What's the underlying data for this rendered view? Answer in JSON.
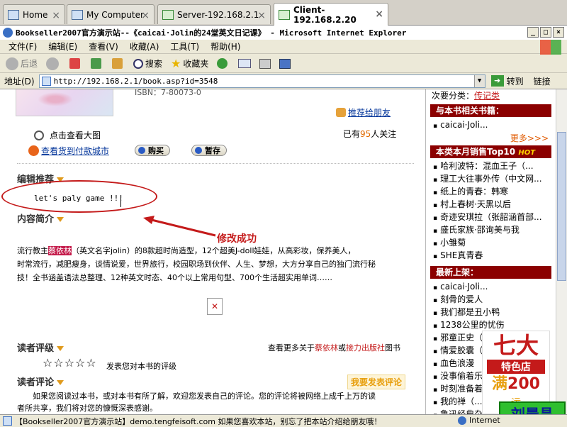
{
  "tabs": [
    {
      "label": "Home"
    },
    {
      "label": "My Computer"
    },
    {
      "label": "Server-192.168.2.1"
    },
    {
      "label": "Client-192.168.2.20"
    }
  ],
  "window": {
    "title": "Bookseller2007官方演示站--《caicai·Jolin的24堂英文日记课》 - Microsoft Internet Explorer",
    "min": "_",
    "max": "□",
    "close": "×"
  },
  "menu": [
    "文件(F)",
    "编辑(E)",
    "查看(V)",
    "收藏(A)",
    "工具(T)",
    "帮助(H)"
  ],
  "toolbar": {
    "back": "后退",
    "search": "搜索",
    "favorites": "收藏夹"
  },
  "address": {
    "label": "地址(D)",
    "url": "http://192.168.2.1/book.asp?id=3548",
    "go": "转到",
    "links": "链接"
  },
  "book": {
    "isbn_partial": "ISBN：7-80073-0",
    "recommend": "推荐给朋友",
    "view_large": "点击查看大图",
    "view_store": "查看货到付款城市",
    "buy": "购买",
    "hold": "暂存",
    "followers_prefix": "已有",
    "followers_count": "95",
    "followers_suffix": "人关注"
  },
  "editor": {
    "heading": "编辑推荐",
    "text": "let's paly game !!!",
    "annotation": "修改成功"
  },
  "intro": {
    "heading": "内容简介",
    "p1_before": "流行教主",
    "p1_author": "蔡依林",
    "p1_after": "（英文名字jolin）的8款超时尚造型，12个超美J-doll娃娃，从高彩妆，保养美人，",
    "p2": "时常流行，减肥瘦身，谈情说爱，世界旅行，校园职场到伙伴、人生、梦想，大方分享自己的独门流行秘",
    "p3": "技！全书涵盖语法总整理、12种英文时态、40个以上常用句型、700个生活超实用单词……"
  },
  "rating": {
    "heading": "读者评级",
    "more_prefix": "查看更多关于",
    "author": "蔡依林",
    "or": "或",
    "publisher": "接力出版社",
    "suffix": "图书",
    "stars": "☆☆☆☆☆",
    "prompt": "发表您对本书的评级"
  },
  "review": {
    "heading": "读者评论",
    "post": "我要发表评论",
    "p1": "如果您阅读过本书，或对本书有所了解，欢迎您发表自己的评论。您的评论将被网络上成千上万的读",
    "p2": "者所共享，我们将对您的慷慨深表感谢。"
  },
  "sidebar": {
    "category_label": "次要分类：",
    "category_value": "传记类",
    "related_title": "与本书相关书籍：",
    "related": [
      "caicai·Joli..."
    ],
    "more": "更多>>>",
    "top10_title": "本类本月销售Top10",
    "hot": "HOT",
    "top10": [
      "哈利波特：混血王子（...",
      "理工大往事外传（中文网...",
      "纸上的青春：韩寒",
      "村上春树·天黑以后",
      "奇迹安琪拉（张韶涵首部...",
      "盛氏家族·邵询美与我",
      "小雏菊",
      "SHE真青春"
    ],
    "new_title": "最新上架：",
    "new": [
      "caicai·Joli...",
      "刻骨的爱人",
      "我们都是丑小鸭",
      "1238公里的忧伤",
      "邪童正史（中国专栏小天...",
      "情爱胶囊（...",
      "血色浪漫",
      "没事偷着乐",
      "时刻准备着",
      "我的禅（...",
      "鲁迅经典杂..."
    ]
  },
  "ad": {
    "title": "七大",
    "store": "特色店",
    "man": "满",
    "amount": "200",
    "line": "运"
  },
  "watermark": "刘晨昌",
  "statusbar": {
    "text": "【Bookseller2007官方演示站】demo.tengfeisoft.com 如果您喜欢本站，别忘了把本站介绍给朋友哦！",
    "zone": "Internet"
  }
}
